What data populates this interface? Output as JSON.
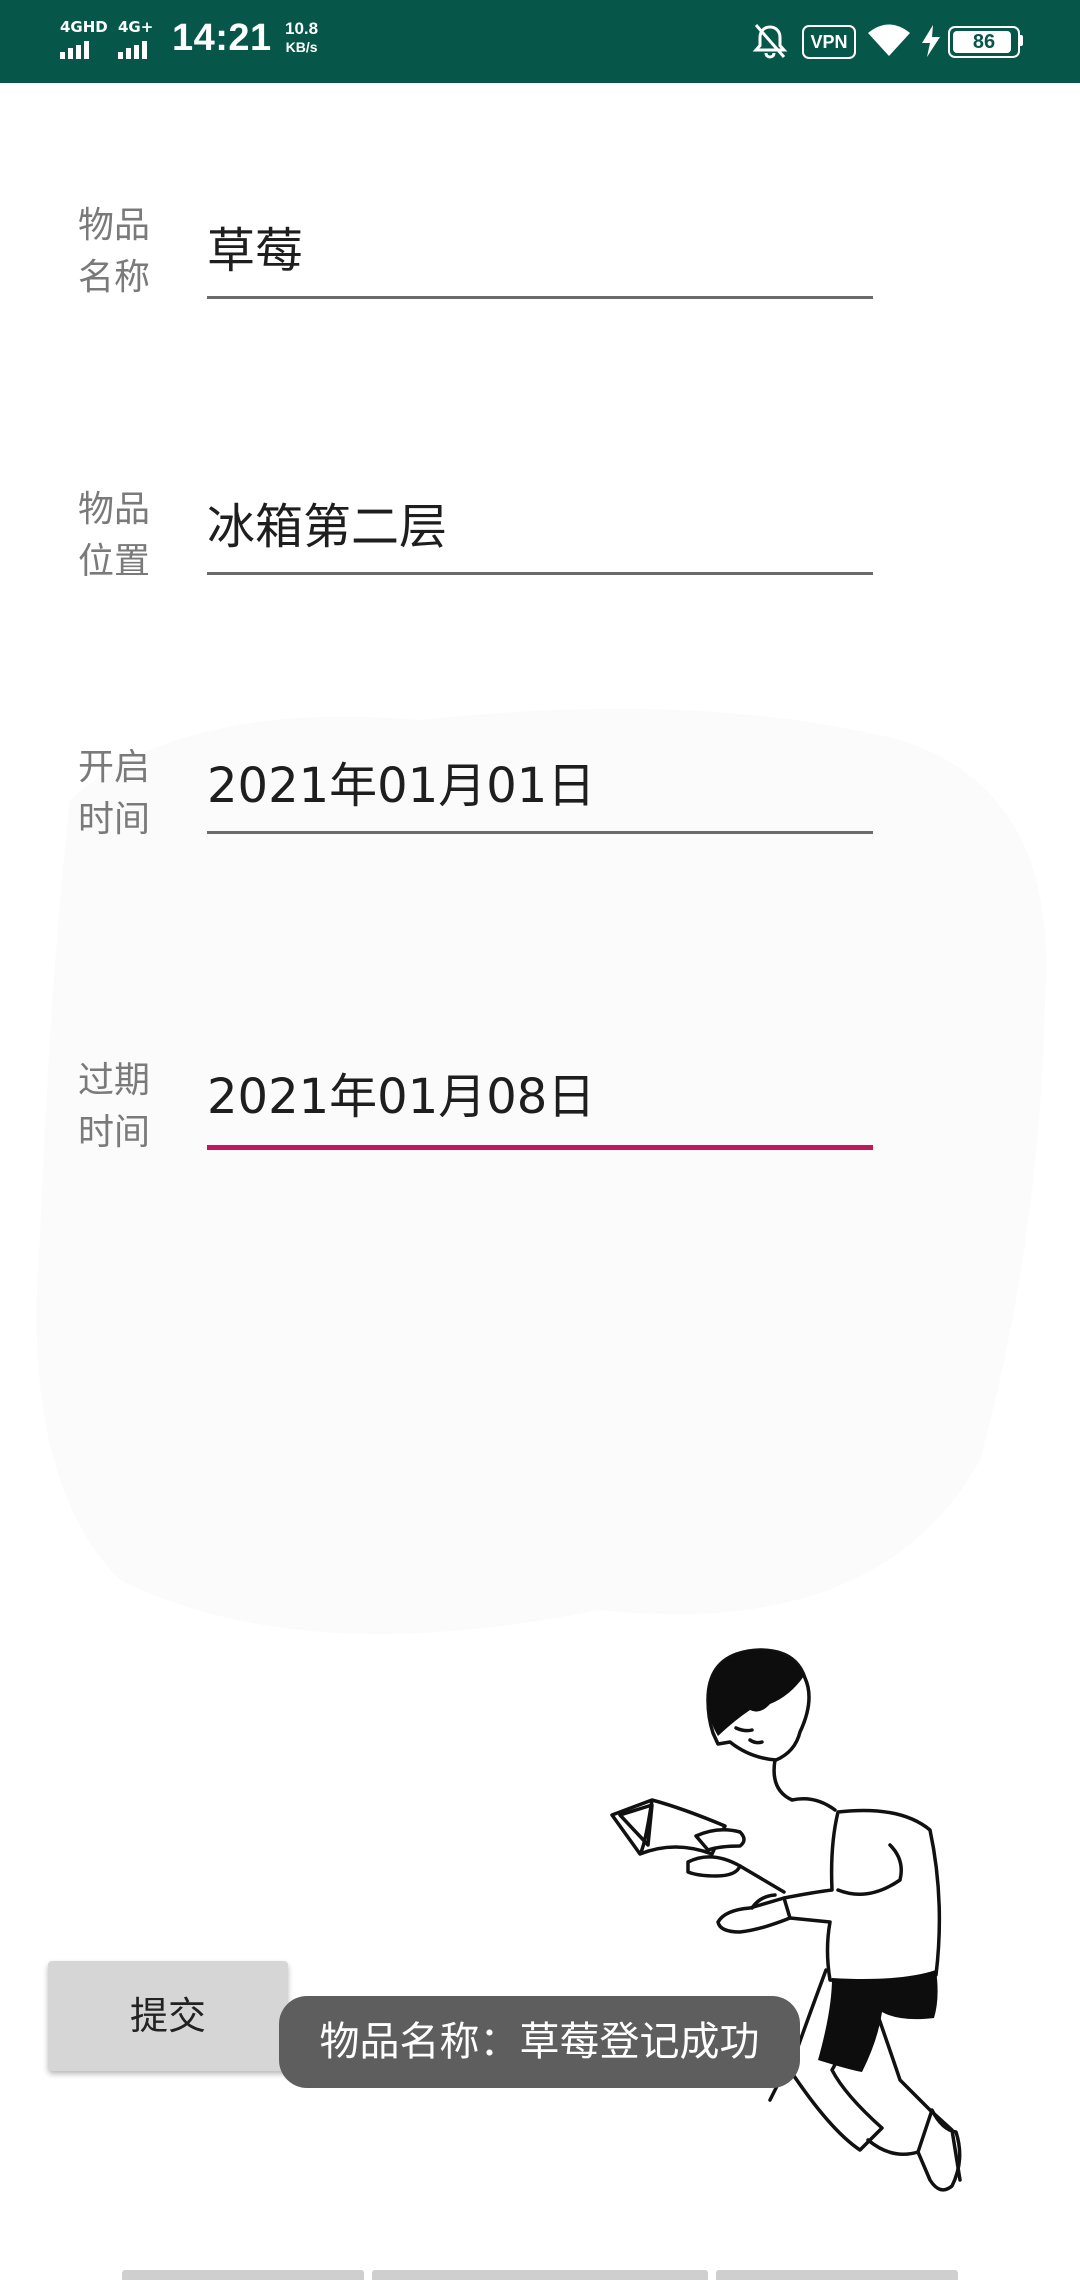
{
  "status_bar": {
    "signal_1_label": "4GHD",
    "signal_2_label": "4G+",
    "time": "14:21",
    "speed_value": "10.8",
    "speed_unit": "KB/s",
    "vpn_label": "VPN",
    "battery_level": "86",
    "background_color": "#06574a"
  },
  "form": {
    "fields": [
      {
        "label_line1": "物品",
        "label_line2": "名称",
        "value": "草莓"
      },
      {
        "label_line1": "物品",
        "label_line2": "位置",
        "value": "冰箱第二层"
      },
      {
        "label_line1": "开启",
        "label_line2": "时间",
        "value": "2021年01月01日"
      },
      {
        "label_line1": "过期",
        "label_line2": "时间",
        "value": "2021年01月08日"
      }
    ],
    "focused_field_index": 3,
    "accent_color": "#c2185b",
    "submit_label": "提交"
  },
  "toast": {
    "message": "物品名称：草莓登记成功"
  },
  "icons": [
    "mute-bell-icon",
    "wifi-icon",
    "charging-bolt-icon",
    "battery-icon",
    "reading-boy-illustration"
  ]
}
